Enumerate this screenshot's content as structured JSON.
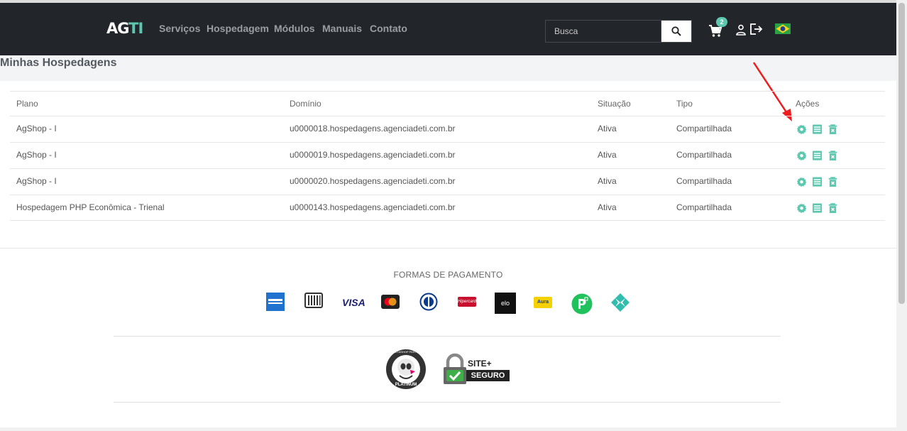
{
  "brand": {
    "logo_ag": "AG",
    "logo_ti": "TI",
    "accent": "#5ec7b0",
    "nav_bg": "#22252a"
  },
  "nav": {
    "links": [
      "Serviços",
      "Hospedagem",
      "Módulos",
      "Manuais",
      "Contato"
    ],
    "search_placeholder": "Busca",
    "cart_count": "2",
    "icons": [
      "search-icon",
      "cart-icon",
      "user-icon",
      "logout-icon",
      "brazil-flag-icon"
    ]
  },
  "page": {
    "title": "Minhas Hospedagens"
  },
  "table": {
    "headers": [
      "Plano",
      "Domínio",
      "Situação",
      "Tipo",
      "Ações"
    ],
    "rows": [
      {
        "plano": "AgShop - I",
        "dominio": "u0000018.hospedagens.agenciadeti.com.br",
        "situacao": "Ativa",
        "tipo": "Compartilhada"
      },
      {
        "plano": "AgShop - I",
        "dominio": "u0000019.hospedagens.agenciadeti.com.br",
        "situacao": "Ativa",
        "tipo": "Compartilhada"
      },
      {
        "plano": "AgShop - I",
        "dominio": "u0000020.hospedagens.agenciadeti.com.br",
        "situacao": "Ativa",
        "tipo": "Compartilhada"
      },
      {
        "plano": "Hospedagem PHP Econômica - Trienal",
        "dominio": "u0000143.hospedagens.agenciadeti.com.br",
        "situacao": "Ativa",
        "tipo": "Compartilhada"
      }
    ],
    "action_icons": [
      "gear-icon",
      "list-icon",
      "trash-icon"
    ]
  },
  "footer": {
    "payments_title": "FORMAS DE PAGAMENTO",
    "payment_methods": [
      "amex-icon",
      "boleto-icon",
      "VISA",
      "mastercard-icon",
      "diners-icon",
      "Hipercard",
      "elo",
      "Aura",
      "picpay-icon",
      "pix-icon"
    ],
    "badges": {
      "prestashop_top": "PRESTASHOP PARTNER",
      "prestashop_bottom": "PLATINUM",
      "site_line1": "SITE",
      "site_line2": "SEGURO"
    }
  }
}
